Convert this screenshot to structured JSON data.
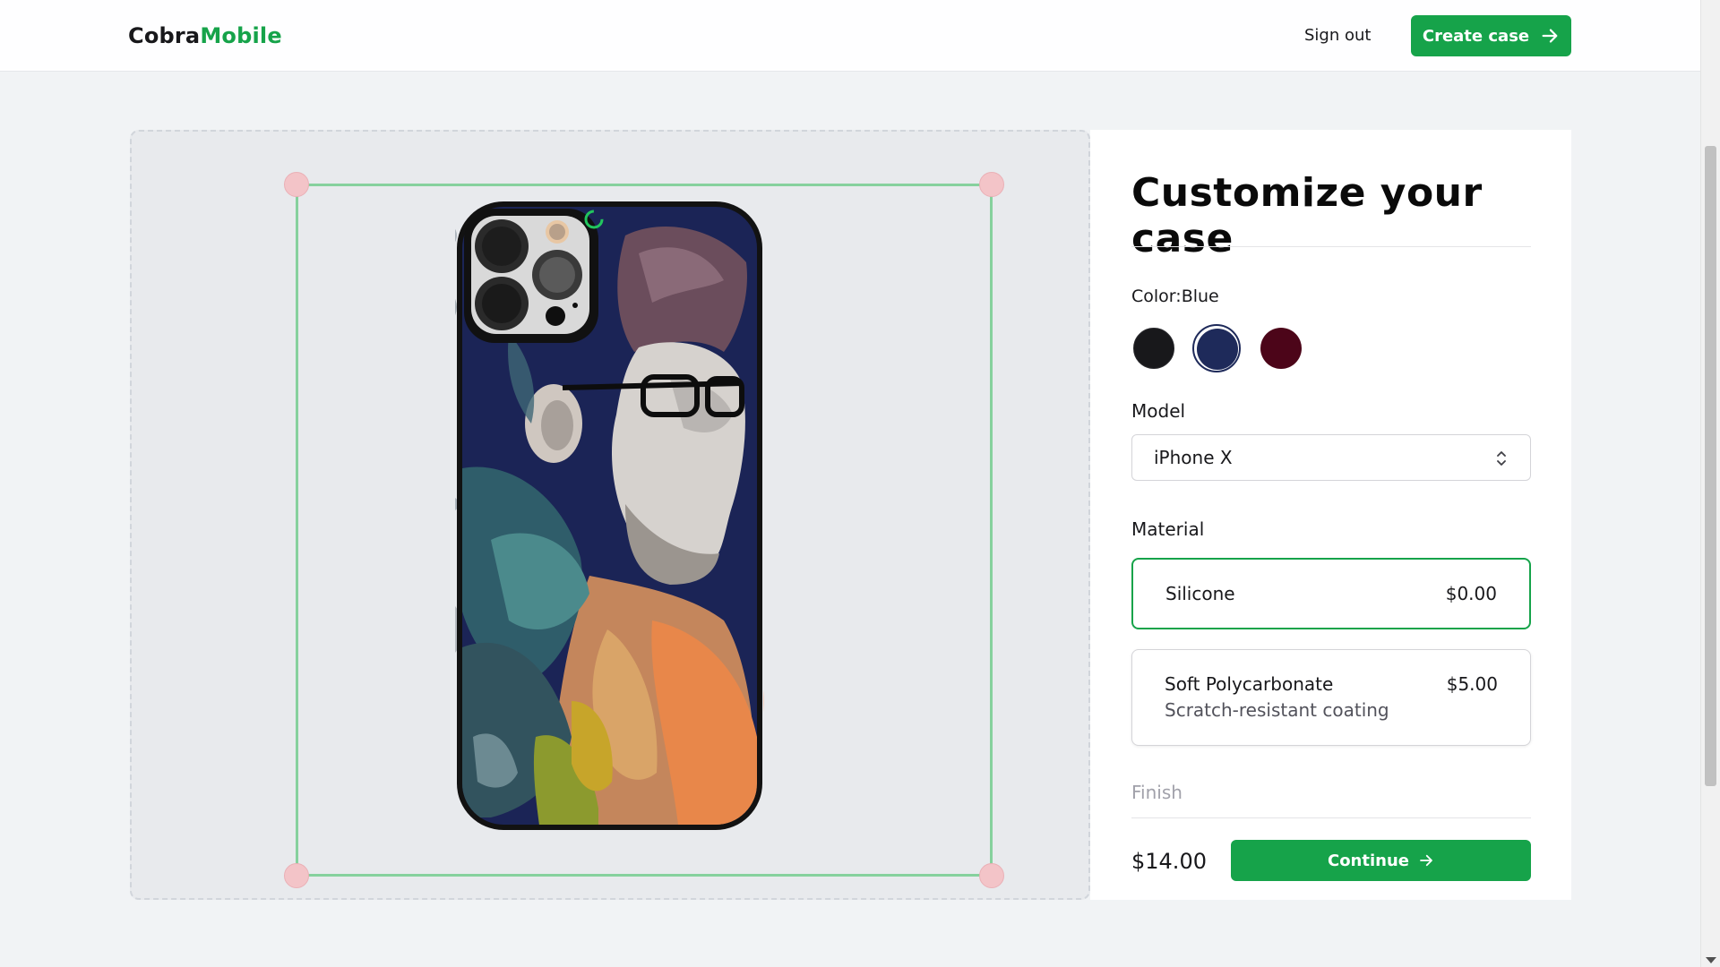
{
  "header": {
    "logo_part1": "Cobra",
    "logo_part2": "Mobile",
    "sign_out": "Sign out",
    "create_case": "Create case"
  },
  "panel": {
    "title": "Customize your case",
    "color_label": "Color:",
    "color_selected": "Blue",
    "colors": [
      {
        "name": "Black",
        "hex": "#18181b"
      },
      {
        "name": "Blue",
        "hex": "#1e2a5a"
      },
      {
        "name": "Rose",
        "hex": "#4c0519"
      }
    ],
    "model_label": "Model",
    "model_value": "iPhone X",
    "material_label": "Material",
    "materials": [
      {
        "name": "Silicone",
        "price": "$0.00",
        "selected": true
      },
      {
        "name": "Soft Polycarbonate",
        "description": "Scratch-resistant coating",
        "price": "$5.00",
        "selected": false
      }
    ],
    "finish_label": "Finish",
    "total": "$14.00",
    "continue": "Continue"
  },
  "theme": {
    "accent": "#16a34a",
    "crop_border": "#86d19d",
    "handle": "#f3c4c8"
  }
}
